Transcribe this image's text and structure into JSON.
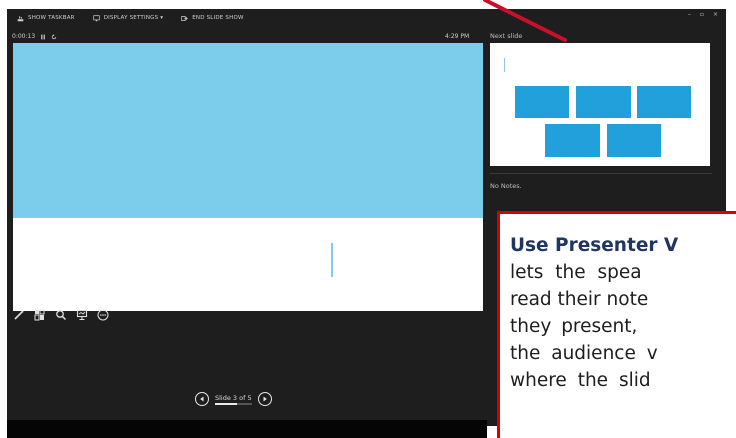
{
  "toolbar": {
    "show_taskbar": "SHOW TASKBAR",
    "display_settings": "DISPLAY SETTINGS ▾",
    "end_slide_show": "END SLIDE SHOW"
  },
  "window_controls": {
    "minimize": "–",
    "restore": "▫",
    "close": "×"
  },
  "timer": {
    "elapsed": "0:00:13"
  },
  "clock": "4:29 PM",
  "next_slide": {
    "label": "Next slide"
  },
  "notes": {
    "text": "No Notes."
  },
  "navigation": {
    "slide_counter": "Slide 3 of 5",
    "current": 3,
    "total": 5
  },
  "tools": [
    "pen-icon",
    "see-all-slides-icon",
    "zoom-icon",
    "screen-icon",
    "more-options-icon"
  ],
  "callout": {
    "lines": [
      "Use Presenter V",
      "lets the spea",
      "read their note",
      "they present, ",
      "the audience v",
      "where the slid"
    ],
    "bold_lines": [
      0
    ]
  },
  "colors": {
    "background": "#1e1e1e",
    "slide_blue": "#7cccec",
    "tile_blue": "#21a0dc",
    "callout_border": "#d60000",
    "arrow": "#c8102e"
  }
}
